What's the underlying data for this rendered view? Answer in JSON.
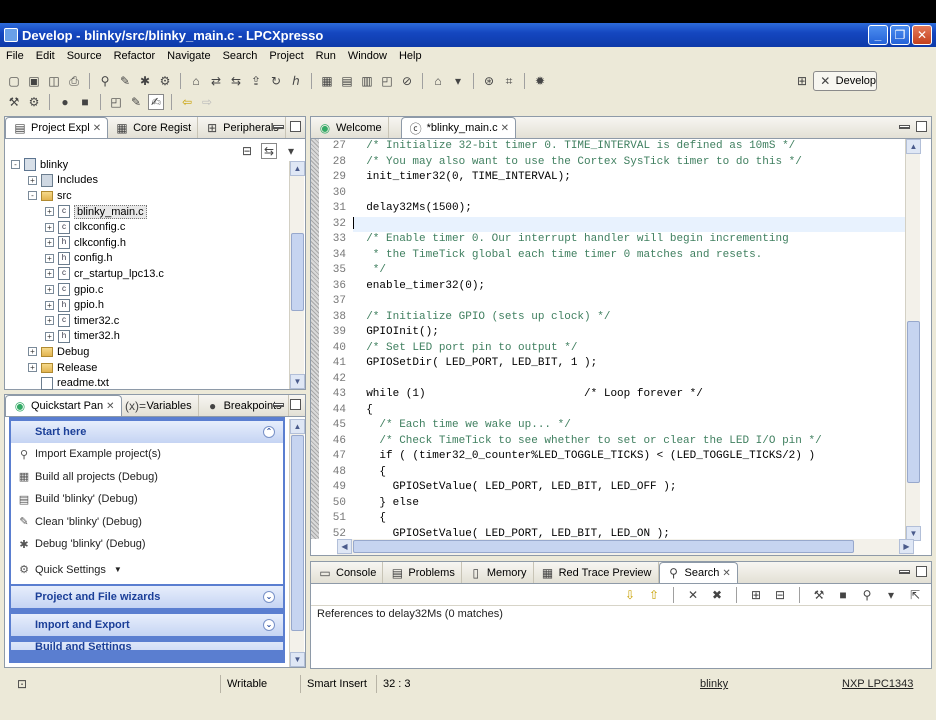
{
  "window": {
    "title": "Develop - blinky/src/blinky_main.c - LPCXpresso",
    "controls": [
      "_",
      "❐",
      "✕"
    ]
  },
  "menu": [
    "File",
    "Edit",
    "Source",
    "Refactor",
    "Navigate",
    "Search",
    "Project",
    "Run",
    "Window",
    "Help"
  ],
  "perspective": {
    "label": "Develop"
  },
  "left_top_panel": {
    "tabs": [
      {
        "label": "Project Expl",
        "active": true
      },
      {
        "label": "Core Regist",
        "active": false
      },
      {
        "label": "Peripherals",
        "active": false
      }
    ],
    "tree": [
      {
        "depth": 0,
        "label": "blinky",
        "icon": "project-icon",
        "expander": "-"
      },
      {
        "depth": 1,
        "label": "Includes",
        "icon": "includes-icon",
        "expander": "+"
      },
      {
        "depth": 1,
        "label": "src",
        "icon": "folder-icon",
        "expander": "-"
      },
      {
        "depth": 2,
        "label": "blinky_main.c",
        "icon": "c-file-icon",
        "expander": "+",
        "selected": true
      },
      {
        "depth": 2,
        "label": "clkconfig.c",
        "icon": "c-file-icon",
        "expander": "+"
      },
      {
        "depth": 2,
        "label": "clkconfig.h",
        "icon": "h-file-icon",
        "expander": "+"
      },
      {
        "depth": 2,
        "label": "config.h",
        "icon": "h-file-icon",
        "expander": "+"
      },
      {
        "depth": 2,
        "label": "cr_startup_lpc13.c",
        "icon": "c-file-icon",
        "expander": "+"
      },
      {
        "depth": 2,
        "label": "gpio.c",
        "icon": "c-file-icon",
        "expander": "+"
      },
      {
        "depth": 2,
        "label": "gpio.h",
        "icon": "h-file-icon",
        "expander": "+"
      },
      {
        "depth": 2,
        "label": "timer32.c",
        "icon": "c-file-icon",
        "expander": "+"
      },
      {
        "depth": 2,
        "label": "timer32.h",
        "icon": "h-file-icon",
        "expander": "+"
      },
      {
        "depth": 1,
        "label": "Debug",
        "icon": "folder-icon",
        "expander": "+"
      },
      {
        "depth": 1,
        "label": "Release",
        "icon": "folder-icon",
        "expander": "+"
      },
      {
        "depth": 1,
        "label": "readme.txt",
        "icon": "text-file-icon",
        "expander": ""
      }
    ]
  },
  "left_bottom_panel": {
    "tabs": [
      {
        "label": "Quickstart Pan",
        "active": true
      },
      {
        "label": "Variables",
        "active": false
      },
      {
        "label": "Breakpoints",
        "active": false
      }
    ],
    "start_here": "Start here",
    "items": [
      {
        "label": "Import Example project(s)",
        "icon": "import-icon"
      },
      {
        "label": "Build all projects (Debug)",
        "icon": "build-all-icon"
      },
      {
        "label": "Build 'blinky' (Debug)",
        "icon": "build-icon"
      },
      {
        "label": "Clean 'blinky' (Debug)",
        "icon": "clean-icon"
      },
      {
        "label": "Debug 'blinky' (Debug)",
        "icon": "debug-icon"
      },
      {
        "label": "Quick Settings",
        "icon": "settings-icon"
      }
    ],
    "sections": [
      "Project and File wizards",
      "Import and Export",
      "Build and Settings"
    ]
  },
  "editor": {
    "tabs": [
      {
        "label": "Welcome",
        "active": false
      },
      {
        "label": "*blinky_main.c",
        "active": true
      }
    ],
    "lines": [
      {
        "n": "27",
        "text": "  /* Initialize 32-bit timer 0. TIME_INTERVAL is defined as 10mS */",
        "comment": true
      },
      {
        "n": "28",
        "text": "  /* You may also want to use the Cortex SysTick timer to do this */",
        "comment": true
      },
      {
        "n": "29",
        "text": "  init_timer32(0, TIME_INTERVAL);",
        "comment": false
      },
      {
        "n": "30",
        "text": "",
        "comment": false
      },
      {
        "n": "31",
        "text": "  delay32Ms(1500);",
        "comment": false
      },
      {
        "n": "32",
        "text": "",
        "comment": false,
        "current": true
      },
      {
        "n": "33",
        "text": "  /* Enable timer 0. Our interrupt handler will begin incrementing",
        "comment": true
      },
      {
        "n": "34",
        "text": "   * the TimeTick global each time timer 0 matches and resets.",
        "comment": true
      },
      {
        "n": "35",
        "text": "   */",
        "comment": true
      },
      {
        "n": "36",
        "text": "  enable_timer32(0);",
        "comment": false
      },
      {
        "n": "37",
        "text": "",
        "comment": false
      },
      {
        "n": "38",
        "text": "  /* Initialize GPIO (sets up clock) */",
        "comment": true
      },
      {
        "n": "39",
        "text": "  GPIOInit();",
        "comment": false
      },
      {
        "n": "40",
        "text": "  /* Set LED port pin to output */",
        "comment": true
      },
      {
        "n": "41",
        "text": "  GPIOSetDir( LED_PORT, LED_BIT, 1 );",
        "comment": false
      },
      {
        "n": "42",
        "text": "",
        "comment": false
      },
      {
        "n": "43",
        "text": "  while (1)                        /* Loop forever */",
        "comment": false
      },
      {
        "n": "44",
        "text": "  {",
        "comment": false
      },
      {
        "n": "45",
        "text": "    /* Each time we wake up... */",
        "comment": true
      },
      {
        "n": "46",
        "text": "    /* Check TimeTick to see whether to set or clear the LED I/O pin */",
        "comment": true
      },
      {
        "n": "47",
        "text": "    if ( (timer32_0_counter%LED_TOGGLE_TICKS) < (LED_TOGGLE_TICKS/2) )",
        "comment": false
      },
      {
        "n": "48",
        "text": "    {",
        "comment": false
      },
      {
        "n": "49",
        "text": "      GPIOSetValue( LED_PORT, LED_BIT, LED_OFF );",
        "comment": false
      },
      {
        "n": "50",
        "text": "    } else",
        "comment": false
      },
      {
        "n": "51",
        "text": "    {",
        "comment": false
      },
      {
        "n": "52",
        "text": "      GPIOSetValue( LED_PORT, LED_BIT, LED_ON );",
        "comment": false
      }
    ]
  },
  "bottom_panel": {
    "tabs": [
      {
        "label": "Console",
        "active": false
      },
      {
        "label": "Problems",
        "active": false
      },
      {
        "label": "Memory",
        "active": false
      },
      {
        "label": "Red Trace Preview",
        "active": false
      },
      {
        "label": "Search",
        "active": true
      }
    ],
    "message": "References to delay32Ms (0 matches)"
  },
  "status": {
    "writable": "Writable",
    "insert_mode": "Smart Insert",
    "position": "32 : 3",
    "project": "blinky",
    "target": "NXP LPC1343"
  }
}
